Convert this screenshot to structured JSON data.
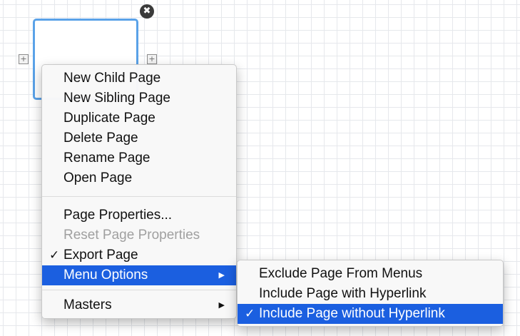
{
  "canvas": {
    "close_glyph": "✖",
    "expand_left_glyph": "+",
    "expand_right_glyph": "+"
  },
  "context_menu": {
    "group1": [
      "New Child Page",
      "New Sibling Page",
      "Duplicate Page",
      "Delete Page",
      "Rename Page",
      "Open Page"
    ],
    "page_properties": "Page Properties...",
    "reset_page_properties": "Reset Page Properties",
    "export_page": "Export Page",
    "export_checked": true,
    "menu_options": "Menu Options",
    "masters": "Masters",
    "check_glyph": "✓",
    "submenu_arrow": "▶"
  },
  "submenu": {
    "items": [
      "Exclude Page From Menus",
      "Include Page with Hyperlink",
      "Include Page without Hyperlink"
    ],
    "selected_index": 2
  },
  "colors": {
    "highlight": "#1b5fe0",
    "node_border": "#5aa2e8",
    "disabled_text": "#a0a0a0"
  }
}
